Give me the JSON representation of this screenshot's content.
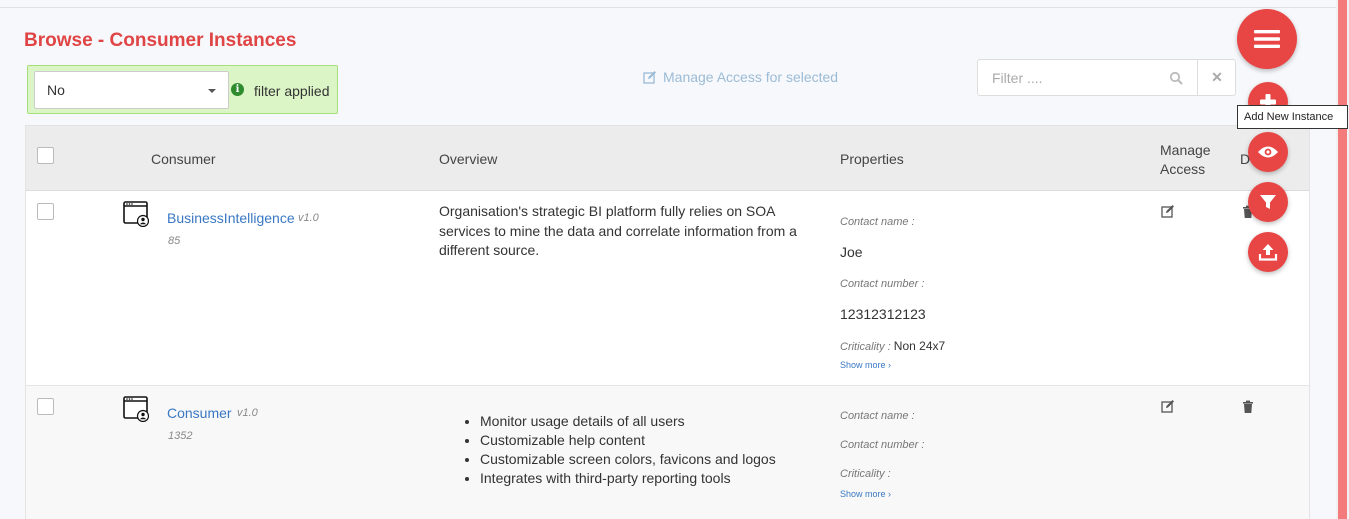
{
  "page": {
    "title": "Browse - Consumer Instances"
  },
  "filter": {
    "selected": "No",
    "status": "filter applied"
  },
  "toolbar": {
    "manage_access_selected": "Manage Access for selected"
  },
  "search": {
    "placeholder": "Filter ....",
    "clear_label": "✕"
  },
  "table": {
    "columns": {
      "consumer": "Consumer",
      "overview": "Overview",
      "properties": "Properties",
      "manage_access_line1": "Manage",
      "manage_access_line2": "Access",
      "delete_partial": "D"
    },
    "property_labels": {
      "contact_name": "Contact name :",
      "contact_number": "Contact number :",
      "criticality": "Criticality :",
      "show_more": "Show more ›"
    },
    "rows": [
      {
        "name": "BusinessIntelligence",
        "version": "v1.0",
        "number": "85",
        "overview": "Organisation's strategic BI platform fully relies on SOA services to mine the data and correlate information from a different source.",
        "contact_name": "Joe",
        "contact_number": "12312312123",
        "criticality": "Non 24x7"
      },
      {
        "name": "Consumer",
        "version": "v1.0",
        "number": "1352",
        "overview_items": [
          "Monitor usage details of all users",
          "Customizable help content",
          "Customizable screen colors, favicons and logos",
          "Integrates with third-party reporting tools"
        ],
        "contact_name": "",
        "contact_number": "",
        "criticality": ""
      }
    ]
  },
  "fab": {
    "tooltip": "Add New Instance"
  },
  "icons": {
    "menu": "hamburger-menu-icon",
    "add": "plus-icon",
    "view": "eye-icon",
    "filter": "funnel-icon",
    "upload": "upload-icon"
  },
  "colors": {
    "accent": "#e84545",
    "title": "#e04545",
    "link": "#3a78c3",
    "filter_bg": "#dcf5c6"
  }
}
